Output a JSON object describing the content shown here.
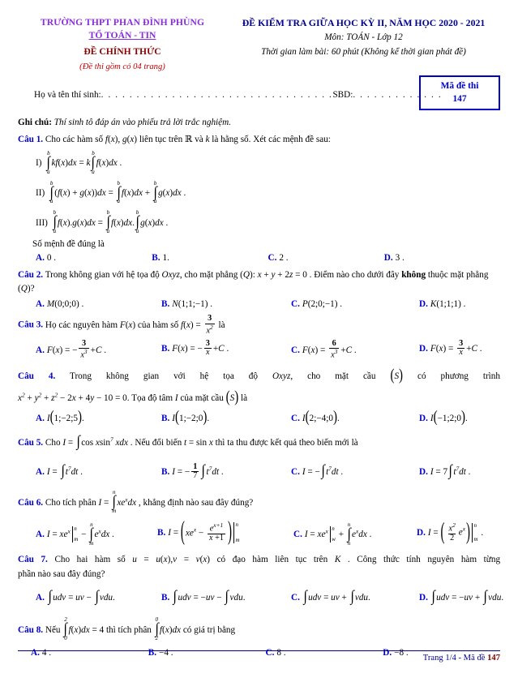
{
  "header": {
    "school": "TRƯỜNG THPT PHAN ĐÌNH PHÙNG",
    "department": "TỔ TOÁN - TIN",
    "official_label": "ĐỀ CHÍNH THỨC",
    "pages_note": "(Đề thi gồm có 04 trang)",
    "exam_title": "ĐỀ KIỂM TRA GIỮA HỌC KỲ II, NĂM HỌC 2020 - 2021",
    "subject": "Môn: TOÁN - Lớp 12",
    "duration": "Thời gian làm bài: 60 phút (Không kể thời gian phát đề)",
    "code_label": "Mã đề thi",
    "code_value": "147",
    "name_label": "Họ và tên thí sinh:",
    "sbd_label": "SBD:",
    "name_dots": ". . . . . . . . . . . . . . . . . . . . . . . . . . . . . . . . .",
    "sbd_dots": ". . . . . . . . . . . . .",
    "note_label": "Ghi chú:",
    "note_text": "Thí sinh tô đáp án vào phiếu trả lời trắc nghiệm."
  },
  "questions": [
    {
      "label": "Câu 1.",
      "text": "Cho các hàm số f(x), g(x) liên tục trên ℝ và k là hằng số. Xét các mệnh đề sau:",
      "statements": [
        "I)",
        "II)",
        "III)"
      ],
      "sub_line": "Số mệnh đề đúng là",
      "options": [
        {
          "letter": "A.",
          "value": "0 ."
        },
        {
          "letter": "B.",
          "value": "1."
        },
        {
          "letter": "C.",
          "value": "2 ."
        },
        {
          "letter": "D.",
          "value": "3 ."
        }
      ]
    },
    {
      "label": "Câu 2.",
      "text": "Trong không gian với hệ tọa độ Oxyz, cho mặt phẳng (Q): x + y + 2z = 0 . Điểm nào cho dưới đây không thuộc mặt phẳng (Q)?",
      "options": [
        {
          "letter": "A.",
          "value": "M(0;0;0) ."
        },
        {
          "letter": "B.",
          "value": "N(1;1;−1) ."
        },
        {
          "letter": "C.",
          "value": "P(2;0;−1) ."
        },
        {
          "letter": "D.",
          "value": "K(1;1;1) ."
        }
      ]
    },
    {
      "label": "Câu 3.",
      "text": "Họ các nguyên hàm F(x) của hàm số f(x) = 3/x² là",
      "options": [
        {
          "letter": "A.",
          "value": "F(x) = −3/x³ + C ."
        },
        {
          "letter": "B.",
          "value": "F(x) = −3/x + C ."
        },
        {
          "letter": "C.",
          "value": "F(x) = 6/x³ + C ."
        },
        {
          "letter": "D.",
          "value": "F(x) = 3/x + C ."
        }
      ]
    },
    {
      "label": "Câu 4.",
      "text": "Trong không gian với hệ tọa độ Oxyz, cho mặt cầu (S) có phương trình x² + y² + z² − 2x + 4y − 10 = 0. Tọa độ tâm I của mặt cầu (S) là",
      "options": [
        {
          "letter": "A.",
          "value": "I(1;−2;5) ."
        },
        {
          "letter": "B.",
          "value": "I(1;−2;0) ."
        },
        {
          "letter": "C.",
          "value": "I(2;−4;0) ."
        },
        {
          "letter": "D.",
          "value": "I(−1;2;0) ."
        }
      ]
    },
    {
      "label": "Câu 5.",
      "text": "Cho I = ∫ cos x sin⁷ x dx . Nếu đổi biến t = sin x thì ta thu được kết quả theo biến mới là",
      "options": [
        {
          "letter": "A.",
          "value": "I = ∫t⁷dt ."
        },
        {
          "letter": "B.",
          "value": "I = −(1/7)∫t⁷dt ."
        },
        {
          "letter": "C.",
          "value": "I = −∫t⁷dt ."
        },
        {
          "letter": "D.",
          "value": "I = 7∫t⁷dt ."
        }
      ]
    },
    {
      "label": "Câu 6.",
      "text": "Cho tích phân I = ∫ₘⁿ xeˣ dx , khẳng định nào sau đây đúng?",
      "options": [
        {
          "letter": "A.",
          "value": "I = xeˣ|ₘⁿ − ∫ₘⁿ eˣdx ."
        },
        {
          "letter": "B.",
          "value": "I = (xeˣ − eˣ⁺¹/(x+1))|ₘⁿ"
        },
        {
          "letter": "C.",
          "value": "I = xeˣ|ₘⁿ + ∫ₘⁿ eˣdx ."
        },
        {
          "letter": "D.",
          "value": "I = (x²/2 · eˣ)|ₘⁿ ."
        }
      ]
    },
    {
      "label": "Câu 7.",
      "text": "Cho hai hàm số u = u(x), v = v(x) có đạo hàm liên tục trên K . Công thức tính nguyên hàm từng phần nào sau đây đúng?",
      "options": [
        {
          "letter": "A.",
          "value": "∫udv = uv − ∫vdu."
        },
        {
          "letter": "B.",
          "value": "∫udv = −uv − ∫vdu."
        },
        {
          "letter": "C.",
          "value": "∫udv = uv + ∫vdu."
        },
        {
          "letter": "D.",
          "value": "∫udv = −uv + ∫vdu."
        }
      ]
    },
    {
      "label": "Câu 8.",
      "text": "Nếu ∫₀² f(x)dx = 4 thì tích phân ∫₂⁰ f(x)dx có giá trị bằng",
      "options": [
        {
          "letter": "A.",
          "value": "4 ."
        },
        {
          "letter": "B.",
          "value": "−4 ."
        },
        {
          "letter": "C.",
          "value": "8 ."
        },
        {
          "letter": "D.",
          "value": "−8 ."
        }
      ]
    }
  ],
  "footer": {
    "page_text": "Trang 1/4 - Mã đề ",
    "page_code": "147"
  }
}
